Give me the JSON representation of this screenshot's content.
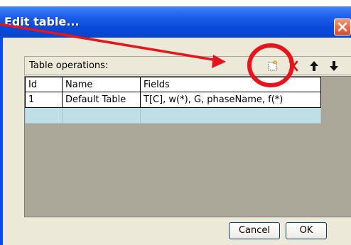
{
  "window": {
    "title": "Edit table..."
  },
  "operations": {
    "label": "Table operations:",
    "icons": [
      "new-table-icon",
      "delete-table-icon",
      "move-up-icon",
      "move-down-icon"
    ]
  },
  "table": {
    "columns": [
      "Id",
      "Name",
      "Fields"
    ],
    "rows": [
      {
        "id": "1",
        "name": "Default Table",
        "fields": "T[C], w(*), G, phaseName, f(*)"
      }
    ]
  },
  "buttons": {
    "cancel": "Cancel",
    "ok": "OK"
  },
  "colors": {
    "titlebar": "#0a48d8",
    "dialog_bg": "#ece9d8",
    "new_row_highlight": "#bfdfe6",
    "annotation_red": "#e8141c"
  }
}
